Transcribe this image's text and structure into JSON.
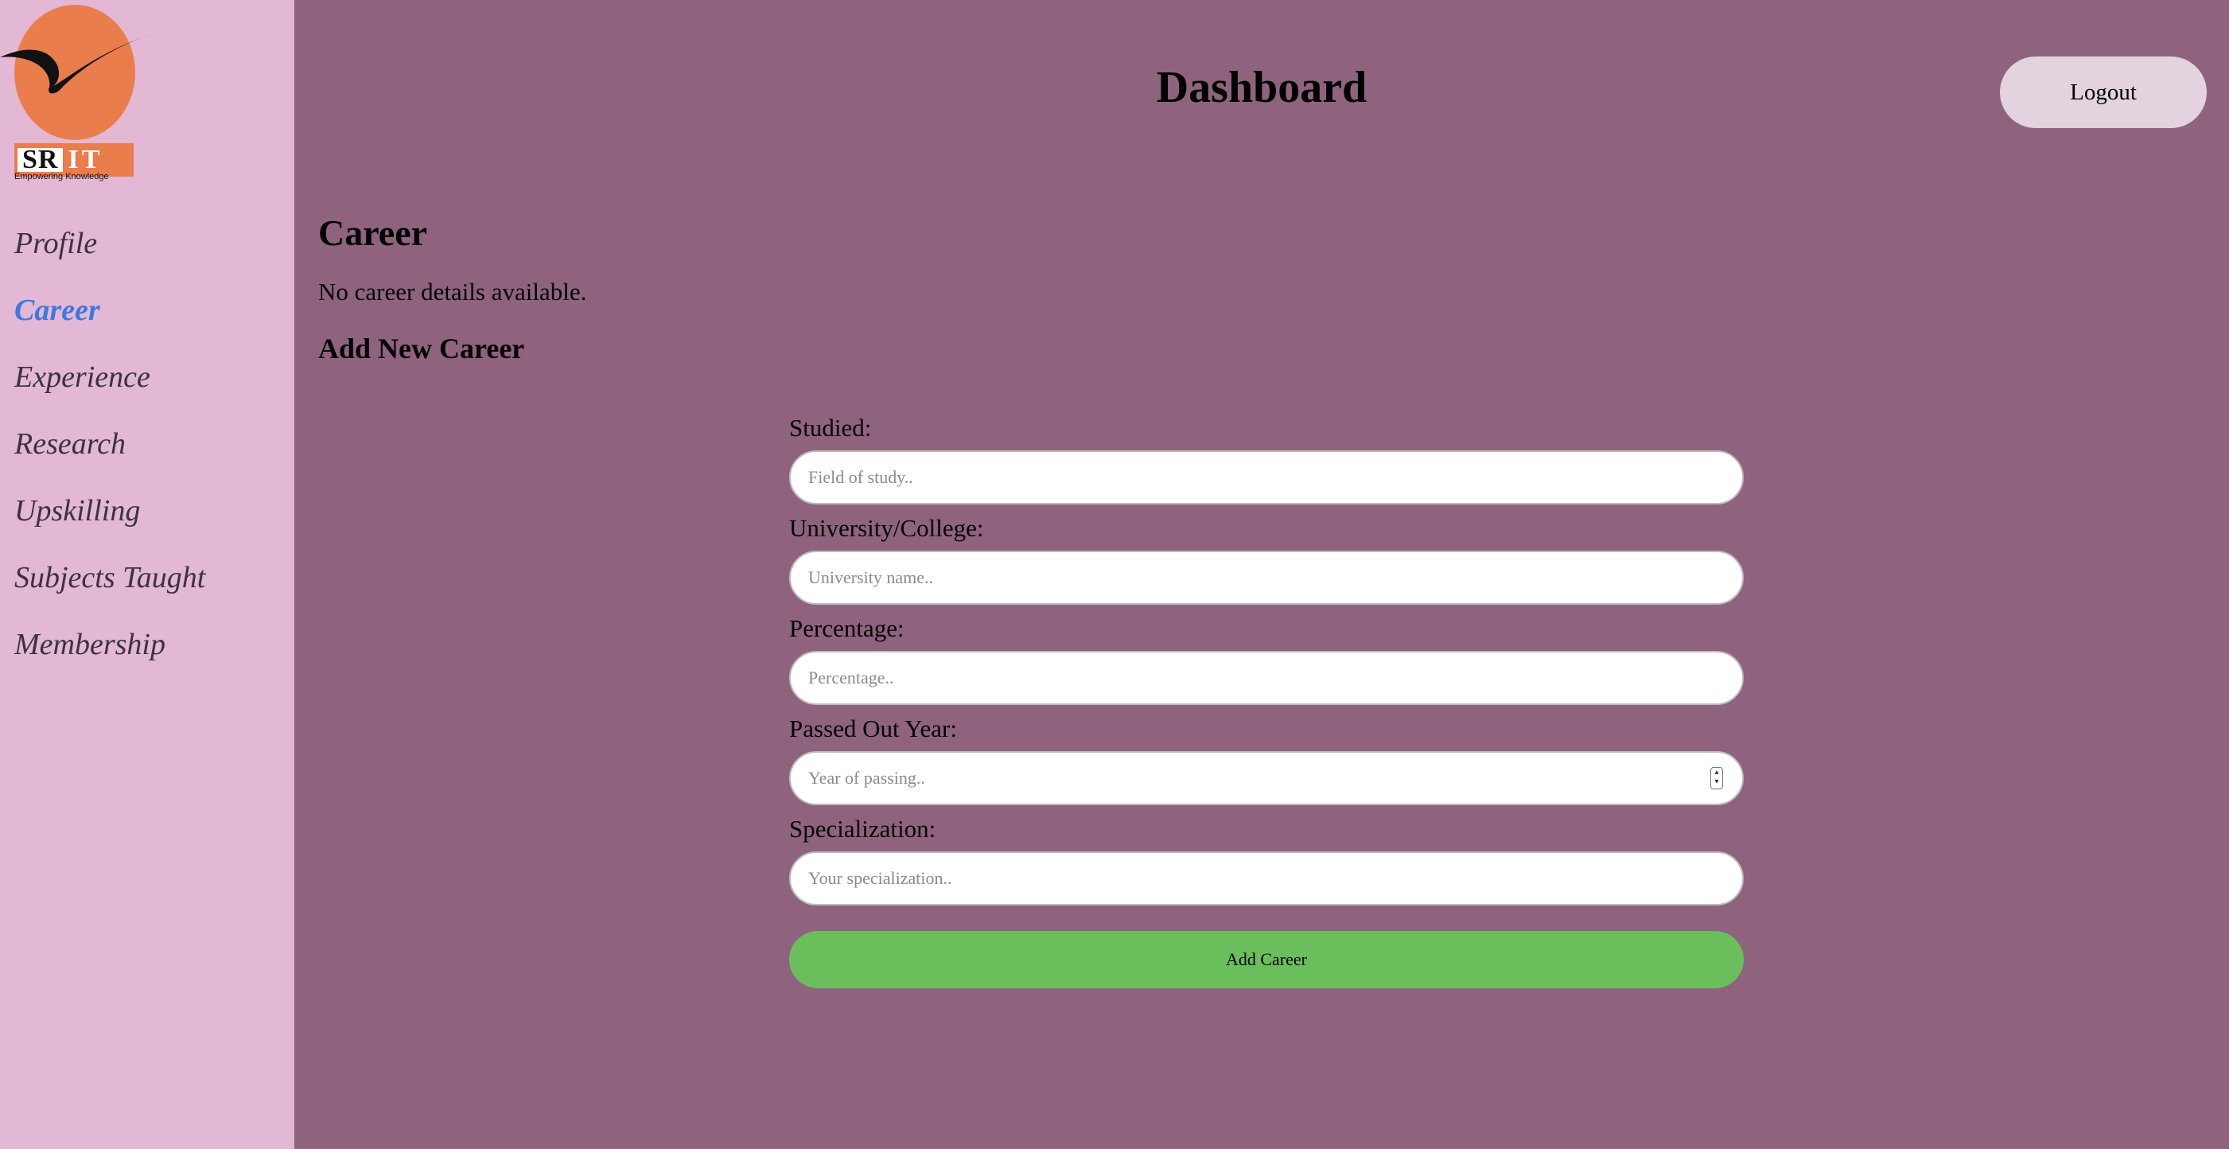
{
  "brand": {
    "logo_text_left": "SR",
    "logo_text_right": "IT",
    "tagline": "Empowering Knowledge",
    "accent": "#e97d4c"
  },
  "sidebar": {
    "items": [
      {
        "label": "Profile"
      },
      {
        "label": "Career",
        "active": true
      },
      {
        "label": "Experience"
      },
      {
        "label": "Research"
      },
      {
        "label": "Upskilling"
      },
      {
        "label": "Subjects Taught"
      },
      {
        "label": "Membership"
      }
    ]
  },
  "header": {
    "title": "Dashboard",
    "logout_label": "Logout"
  },
  "main": {
    "section_title": "Career",
    "empty_message": "No career details available.",
    "add_heading": "Add New Career",
    "form": {
      "studied": {
        "label": "Studied:",
        "placeholder": "Field of study.."
      },
      "university": {
        "label": "University/College:",
        "placeholder": "University name.."
      },
      "percentage": {
        "label": "Percentage:",
        "placeholder": "Percentage.."
      },
      "passed_year": {
        "label": "Passed Out Year:",
        "placeholder": "Year of passing.."
      },
      "specialization": {
        "label": "Specialization:",
        "placeholder": "Your specialization.."
      },
      "submit_label": "Add Career"
    }
  },
  "colors": {
    "sidebar_bg": "#e2b8d4",
    "main_bg": "#8f637e",
    "active_nav": "#3e78e0",
    "submit_bg": "#6abf5c"
  }
}
